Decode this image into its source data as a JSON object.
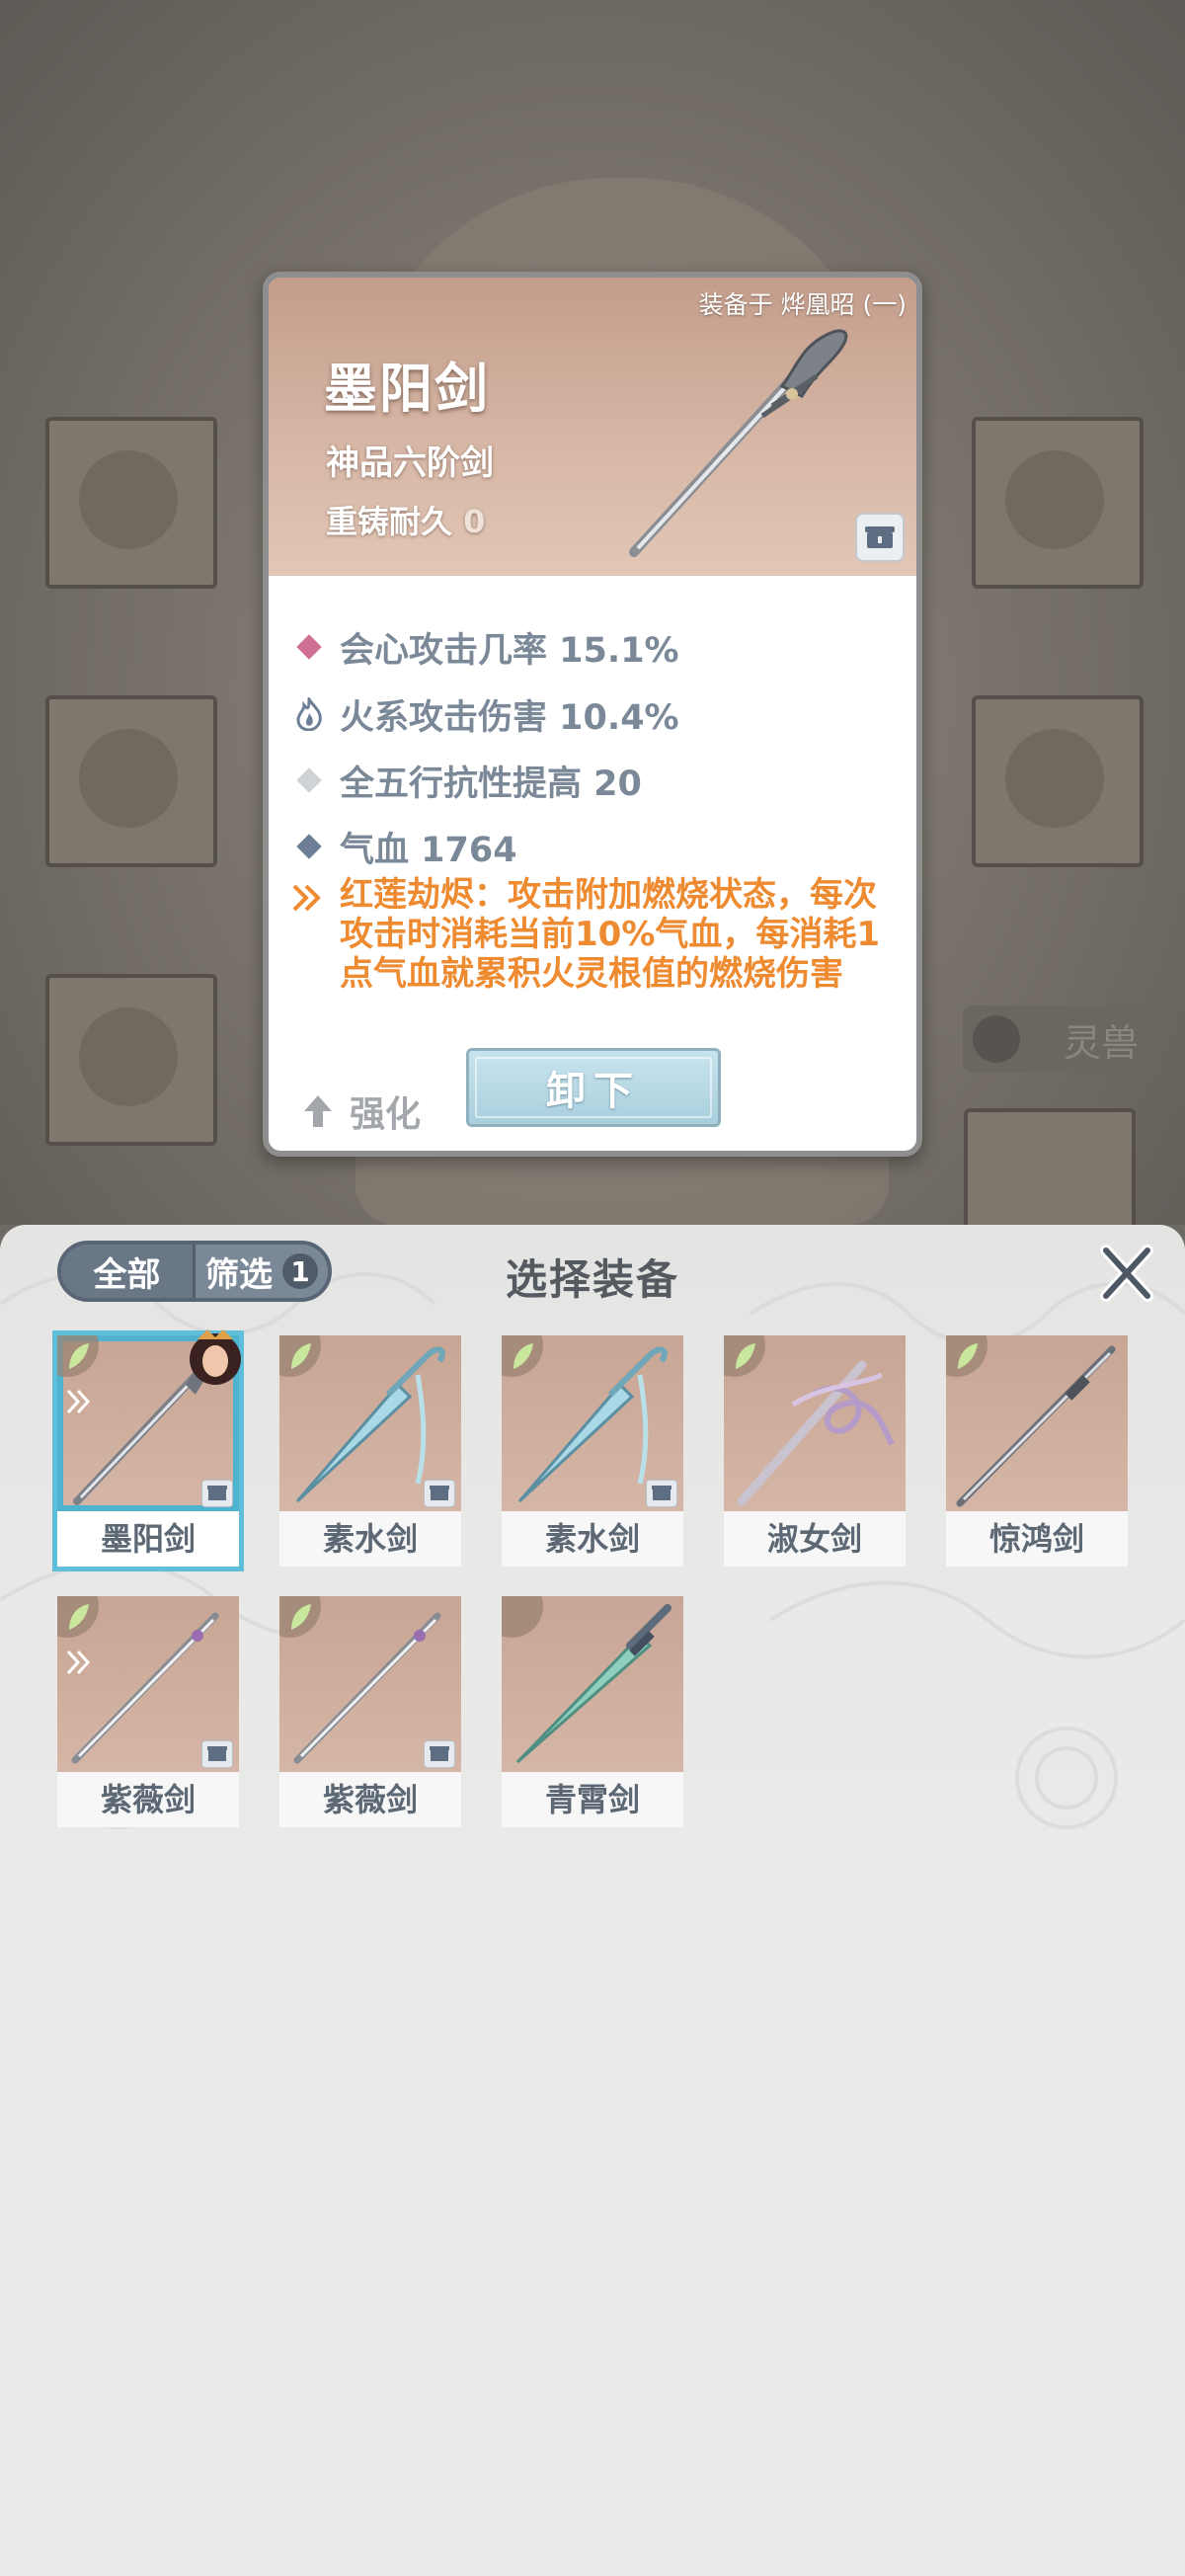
{
  "background": {
    "right_label": "灵兽"
  },
  "detail": {
    "equipped_on": "装备于 烨凰昭 (一)",
    "name": "墨阳剑",
    "grade": "神品六阶剑",
    "recast_label": "重铸耐久",
    "recast_value": "0",
    "stats": [
      {
        "text": "会心攻击几率 15.1%",
        "marker": "pink-diamond"
      },
      {
        "text": "火系攻击伤害 10.4%",
        "marker": "fire-icon"
      },
      {
        "text": "全五行抗性提高 20",
        "marker": "grey-diamond"
      },
      {
        "text": "气血 1764",
        "marker": "blue-diamond"
      }
    ],
    "skill": "红莲劫烬：攻击附加燃烧状态，每次攻击时消耗当前10%气血，每消耗1点气血就累积火灵根值的燃烧伤害",
    "strengthen_label": "强化",
    "unequip_label": "卸下"
  },
  "panel": {
    "tab_all": "全部",
    "tab_filter": "筛选",
    "filter_count": "1",
    "title": "选择装备",
    "items": [
      {
        "name": "墨阳剑",
        "selected": true
      },
      {
        "name": "素水剑",
        "selected": false
      },
      {
        "name": "素水剑",
        "selected": false
      },
      {
        "name": "淑女剑",
        "selected": false
      },
      {
        "name": "惊鸿剑",
        "selected": false
      },
      {
        "name": "紫薇剑",
        "selected": false
      },
      {
        "name": "紫薇剑",
        "selected": false
      },
      {
        "name": "青霄剑",
        "selected": false
      }
    ]
  },
  "colors": {
    "accent_skill": "#ee8a30",
    "stat_text": "#7a8898",
    "selected_border": "#5fbfdb",
    "thumb_bg": "#c8a594"
  }
}
